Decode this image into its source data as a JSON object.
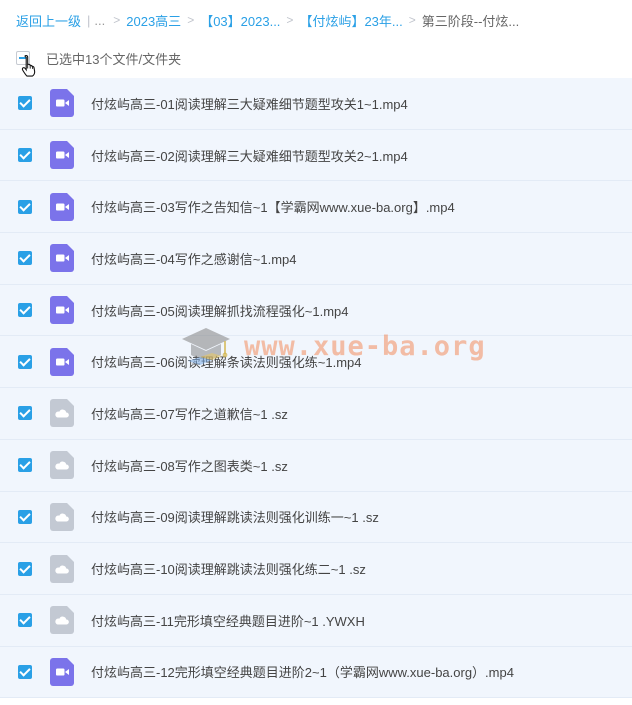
{
  "breadcrumb": {
    "back_label": "返回上一级",
    "ellipsis": "...",
    "items": [
      "2023高三",
      "【03】2023...",
      "【付炫屿】23年...",
      "第三阶段--付炫..."
    ]
  },
  "selection": {
    "status": "已选中13个文件/文件夹"
  },
  "files": [
    {
      "name": "付炫屿高三-01阅读理解三大疑难细节题型攻关1~1.mp4",
      "icon": "video-icon"
    },
    {
      "name": "付炫屿高三-02阅读理解三大疑难细节题型攻关2~1.mp4",
      "icon": "video-icon"
    },
    {
      "name": "付炫屿高三-03写作之告知信~1【学霸网www.xue-ba.org】.mp4",
      "icon": "video-icon"
    },
    {
      "name": "付炫屿高三-04写作之感谢信~1.mp4",
      "icon": "video-icon"
    },
    {
      "name": "付炫屿高三-05阅读理解抓找流程强化~1.mp4",
      "icon": "video-icon"
    },
    {
      "name": "付炫屿高三-06阅读理解条读法则强化练~1.mp4",
      "icon": "video-icon"
    },
    {
      "name": "付炫屿高三-07写作之道歉信~1 .sz",
      "icon": "cloud-file-icon"
    },
    {
      "name": "付炫屿高三-08写作之图表类~1 .sz",
      "icon": "cloud-file-icon"
    },
    {
      "name": "付炫屿高三-09阅读理解跳读法则强化训练一~1 .sz",
      "icon": "cloud-file-icon"
    },
    {
      "name": "付炫屿高三-10阅读理解跳读法则强化练二~1 .sz",
      "icon": "cloud-file-icon"
    },
    {
      "name": "付炫屿高三-11完形填空经典题目进阶~1 .YWXH",
      "icon": "cloud-file-icon"
    },
    {
      "name": "付炫屿高三-12完形填空经典题目进阶2~1（学霸网www.xue-ba.org）.mp4",
      "icon": "video-icon"
    }
  ],
  "watermark": {
    "text": "www.xue-ba.org"
  },
  "colors": {
    "accent": "#2aa0e6",
    "row_bg": "#f1f6fd",
    "video_icon": "#7b73ea",
    "cloud_icon": "#c3c9d3",
    "watermark": "#f28c5c"
  }
}
